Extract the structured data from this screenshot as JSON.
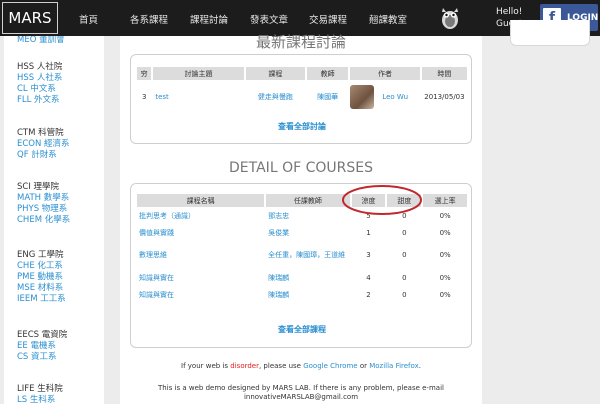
{
  "header": {
    "logo": "MARS",
    "nav": [
      "首頁",
      "各系課程",
      "課程討論",
      "發表文章",
      "交易課程",
      "翹課教室"
    ],
    "greeting_line1": "Hello!",
    "greeting_line2": "Guest",
    "login_label": "LOGIN",
    "fb_glyph": "f"
  },
  "sidebar": {
    "top_link": "MEO 董訓會",
    "groups": [
      {
        "title": "HSS 人社院",
        "links": [
          "HSS 人社系",
          "CL 中文系",
          "FLL 外文系"
        ]
      },
      {
        "title": "CTM 科管院",
        "links": [
          "ECON 經濟系",
          "QF 計財系"
        ]
      },
      {
        "title": "SCI 理學院",
        "links": [
          "MATH 數學系",
          "PHYS 物理系",
          "CHEM 化學系"
        ]
      },
      {
        "title": "ENG 工學院",
        "links": [
          "CHE 化工系",
          "PME 動機系",
          "MSE 材料系",
          "IEEM 工工系"
        ]
      },
      {
        "title": "EECS 電資院",
        "links": [
          "EE 電機系",
          "CS 資工系"
        ]
      },
      {
        "title": "LIFE 生科院",
        "links": [
          "LS 生科系"
        ]
      }
    ]
  },
  "discussions": {
    "title": "最新課程討論",
    "columns": [
      "穷",
      "討論主題",
      "課程",
      "教師",
      "作者",
      "時間"
    ],
    "rows": [
      {
        "no": "3",
        "topic": "test",
        "course": "健走與慢跑",
        "teacher": "陳國華",
        "author": "Leo Wu",
        "time": "2013/05/03"
      }
    ],
    "more": "查看全部討論"
  },
  "courses": {
    "title": "DETAIL OF COURSES",
    "columns": [
      "課程名稱",
      "任課教師",
      "涼度",
      "甜度",
      "選上率"
    ],
    "rows": [
      {
        "name": "批判思考（通識）",
        "teacher": "鄧志忠",
        "cool": "5",
        "sweet": "0",
        "rate": "0%"
      },
      {
        "name": "價值與實踐",
        "teacher": "吳俊業",
        "cool": "1",
        "sweet": "0",
        "rate": "0%"
      },
      {
        "name": "數理思維",
        "teacher": "全任重，陳國璋，王道維",
        "cool": "3",
        "sweet": "0",
        "rate": "0%"
      },
      {
        "name": "知識與實在",
        "teacher": "陳瑞麟",
        "cool": "4",
        "sweet": "0",
        "rate": "0%"
      },
      {
        "name": "知識與實在",
        "teacher": "陳瑞麟",
        "cool": "2",
        "sweet": "0",
        "rate": "0%"
      }
    ],
    "more": "查看全部課程"
  },
  "footer": {
    "line1_prefix": "If your web is ",
    "line1_red": "disorder",
    "line1_mid": ", please use ",
    "chrome": "Google Chrome",
    "or": " or ",
    "firefox": "Mozilla Firefox",
    "line1_end": ".",
    "line2": "This is a web demo designed by MARS LAB. If there is any problem, please e-mail",
    "line3": "innovativeMARSLAB@gmail.com"
  },
  "colors": {
    "link": "#2a8fd0",
    "topbar": "#1c1c1c",
    "facebook": "#3b5998",
    "annotation": "#c0282d"
  }
}
